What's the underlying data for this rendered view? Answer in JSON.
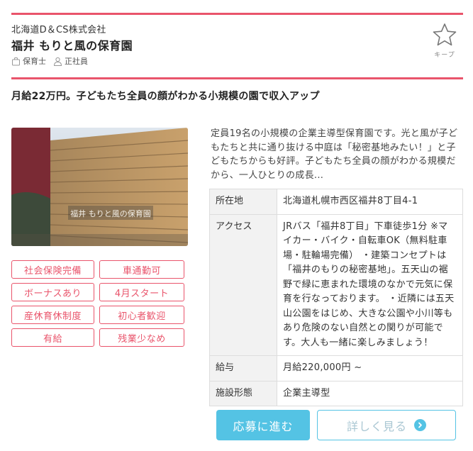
{
  "header": {
    "company": "北海道D＆CS株式会社",
    "title": "福井 もりと風の保育園",
    "job_type": "保育士",
    "employment": "正社員",
    "keep_label": "キープ"
  },
  "catch_copy": "月給22万円。子どもたち全員の顔がわかる小規模の園で収入アップ",
  "photo": {
    "sign_text": "福井 もりと風の保育園"
  },
  "features": [
    "社会保険完備",
    "車通勤可",
    "ボーナスあり",
    "4月スタート",
    "産休育休制度",
    "初心者歓迎",
    "有給",
    "残業少なめ"
  ],
  "description": "定員19名の小規模の企業主導型保育園です。光と風が子どもたちと共に通り抜ける中庭は「秘密基地みたい！」と子どもたちからも好評。子どもたち全員の顔がわかる規模だから、一人ひとりの成長...",
  "info": {
    "location_label": "所在地",
    "location_value": "北海道札幌市西区福井8丁目4-1",
    "access_label": "アクセス",
    "access_value": "JRバス「福井8丁目」下車徒歩1分 ※マイカー・バイク・自転車OK（無料駐車場・駐輪場完備） ・建築コンセプトは「福井のもりの秘密基地」。五天山の裾野で緑に恵まれた環境のなかで元気に保育を行なっております。 ・近隣には五天山公園をはじめ、大きな公園や小川等もあり危険のない自然との関りが可能です。大人も一緒に楽しみましょう！",
    "salary_label": "給与",
    "salary_value": "月給220,000円 ~",
    "facility_label": "施設形態",
    "facility_value": "企業主導型"
  },
  "buttons": {
    "apply": "応募に進む",
    "detail": "詳しく見る"
  },
  "colors": {
    "accent": "#e9546b",
    "button": "#54c3e4"
  }
}
